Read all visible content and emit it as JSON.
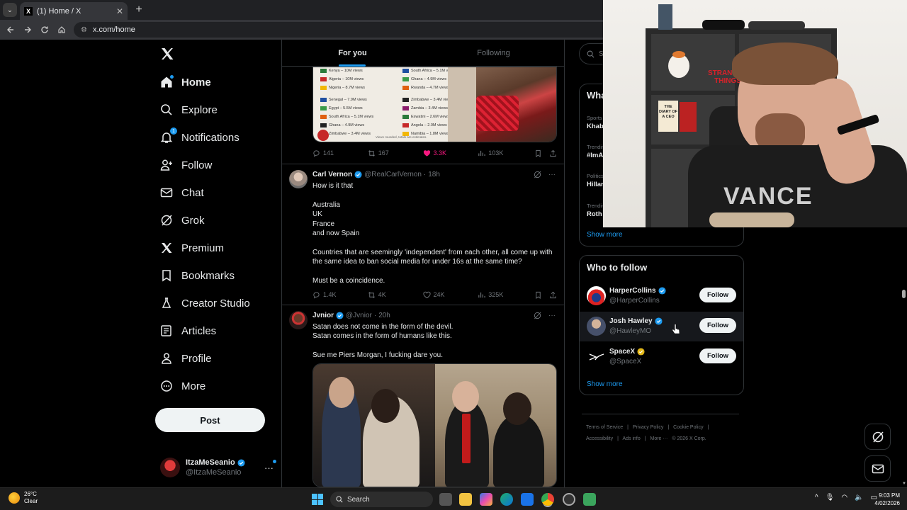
{
  "browser": {
    "tab_title": "(1) Home / X",
    "url": "x.com/home"
  },
  "nav": {
    "items": [
      {
        "label": "Home"
      },
      {
        "label": "Explore"
      },
      {
        "label": "Notifications",
        "badge": "1"
      },
      {
        "label": "Follow"
      },
      {
        "label": "Chat"
      },
      {
        "label": "Grok"
      },
      {
        "label": "Premium"
      },
      {
        "label": "Bookmarks"
      },
      {
        "label": "Creator Studio"
      },
      {
        "label": "Articles"
      },
      {
        "label": "Profile"
      },
      {
        "label": "More"
      }
    ],
    "post_label": "Post",
    "account": {
      "display_name": "ItzaMeSeanio",
      "handle": "@ItzaMeSeanio"
    }
  },
  "feed": {
    "tabs": [
      {
        "label": "For you"
      },
      {
        "label": "Following"
      }
    ],
    "media1_rows": [
      [
        "Kenya – 10M views",
        "South Africa – 5.1M views"
      ],
      [
        "Algeria – 10M views",
        "Ghana – 4.9M views"
      ],
      [
        "Nigeria – 8.7M views",
        "Rwanda – 4.7M views"
      ],
      [
        "Senegal – 7.9M views",
        "Zimbabwe – 3.4M views"
      ],
      [
        "Egypt – 5.5M views",
        "Zambia – 3.4M views"
      ],
      [
        "South Africa – 5.1M views",
        "Eswatini – 2.6M views"
      ],
      [
        "Ghana – 4.9M views",
        "Angola – 2.0M views"
      ],
      [
        "Zimbabwe – 3.4M views",
        "Namibia – 1.8M views"
      ]
    ],
    "media1_footnote": "Views rounded, totals are estimates.",
    "post1_actions": {
      "replies": "141",
      "reposts": "167",
      "likes": "3.3K",
      "views": "103K"
    },
    "tweets": [
      {
        "display_name": "Carl Vernon",
        "handle": "@RealCarlVernon",
        "time": "18h",
        "text": "How is it that\n\nAustralia\nUK\nFrance\nand now Spain\n\nCountries that are seemingly 'independent' from each other, all come up with the same idea to ban social media for under 16s at the same time?\n\nMust be a coincidence.",
        "replies": "1.4K",
        "reposts": "4K",
        "likes": "24K",
        "views": "325K"
      },
      {
        "display_name": "Jvnior",
        "handle": "@Jvnior",
        "time": "20h",
        "text": "Satan does not come in the form of the devil.\nSatan comes in the form of humans like this.\n\nSue me Piers Morgan, I fucking dare you."
      }
    ]
  },
  "right": {
    "search_placeholder": "Search",
    "trends_title": "What's happening",
    "trends": [
      {
        "category": "Sports",
        "name": "Khabib"
      },
      {
        "category": "Trending",
        "name": "#ImA"
      },
      {
        "category": "Politics",
        "name": "Hillary"
      },
      {
        "category": "Trending",
        "name": "Roth"
      }
    ],
    "show_more": "Show more",
    "wtf_title": "Who to follow",
    "who_to_follow": [
      {
        "display_name": "HarperCollins",
        "handle": "@HarperCollins",
        "button": "Follow",
        "verified": "blue"
      },
      {
        "display_name": "Josh Hawley",
        "handle": "@HawleyMO",
        "button": "Follow",
        "verified": "blue"
      },
      {
        "display_name": "SpaceX",
        "handle": "@SpaceX",
        "button": "Follow",
        "verified": "gold"
      }
    ],
    "footer_links": [
      "Terms of Service",
      "|",
      "Privacy Policy",
      "|",
      "Cookie Policy",
      "|",
      "Accessibility",
      "|",
      "Ads info",
      "|",
      "More ···",
      "© 2026 X Corp."
    ]
  },
  "webcam": {
    "book_title": "THE DIARY OF A CEO",
    "sign": "STRANGER THINGS",
    "shirt_text": "VANCE"
  },
  "taskbar": {
    "temperature": "26°C",
    "condition": "Clear",
    "search_label": "Search",
    "time": "9:03 PM",
    "date": "4/02/2026"
  },
  "colors": {
    "accent": "#1d9bf0",
    "like": "#f91880",
    "gold": "#e2b719"
  }
}
